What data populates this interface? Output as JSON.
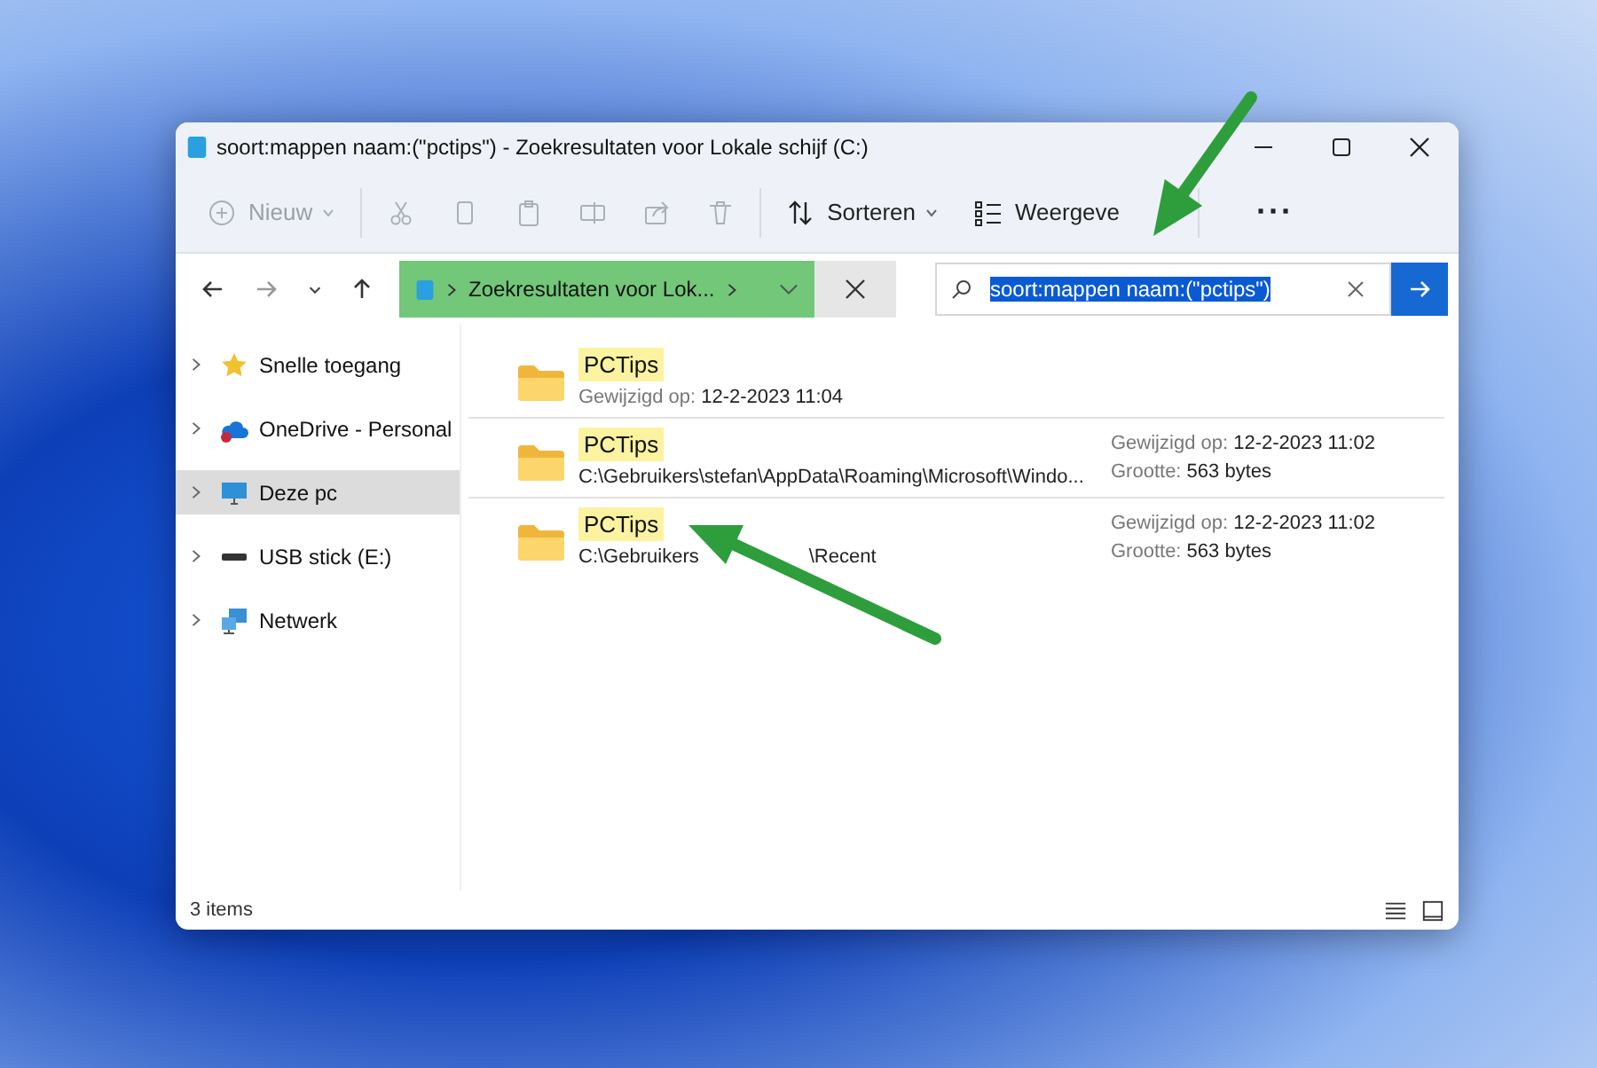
{
  "window": {
    "title": "soort:mappen naam:(\"pctips\") - Zoekresultaten voor Lokale schijf (C:)"
  },
  "toolbar": {
    "items": [
      {
        "kind": "new",
        "label": "Nieuw",
        "disabled": true
      },
      {
        "kind": "cut",
        "disabled": true
      },
      {
        "kind": "copy",
        "disabled": true
      },
      {
        "kind": "paste",
        "disabled": true
      },
      {
        "kind": "rename",
        "disabled": true
      },
      {
        "kind": "share",
        "disabled": true
      },
      {
        "kind": "delete",
        "disabled": true
      },
      {
        "kind": "sort",
        "label": "Sorteren",
        "disabled": false
      },
      {
        "kind": "view",
        "label": "Weergeve",
        "disabled": false
      },
      {
        "kind": "more",
        "label": "···",
        "disabled": false
      }
    ]
  },
  "address_bar": {
    "path": "Zoekresultaten voor Lok...",
    "highlighted": true
  },
  "search": {
    "value": "soort:mappen naam:(\"pctips\")",
    "selected": true
  },
  "sidebar": {
    "items": [
      {
        "kind": "star",
        "label": "Snelle toegang",
        "selected": false
      },
      {
        "kind": "cloud",
        "label": "OneDrive - Personal",
        "selected": false
      },
      {
        "kind": "pc",
        "label": "Deze pc",
        "selected": true
      },
      {
        "kind": "drive",
        "label": "USB stick (E:)",
        "selected": false
      },
      {
        "kind": "network",
        "label": "Netwerk",
        "selected": false
      }
    ]
  },
  "results": [
    {
      "name": "PCTips",
      "line2": {
        "label": "Gewijzigd op:",
        "value": "12-2-2023 11:04"
      }
    },
    {
      "name": "PCTips",
      "path": "C:\\Gebruikers\\stefan\\AppData\\Roaming\\Microsoft\\Windo...",
      "meta": [
        {
          "label": "Gewijzigd op:",
          "value": "12-2-2023 11:02"
        },
        {
          "label": "Grootte:",
          "value": "563 bytes"
        }
      ]
    },
    {
      "name": "PCTips",
      "path_fragments": [
        "C:\\Gebruikers",
        "\\Recent"
      ],
      "meta": [
        {
          "label": "Gewijzigd op:",
          "value": "12-2-2023 11:02"
        },
        {
          "label": "Grootte:",
          "value": "563 bytes"
        }
      ]
    }
  ],
  "status_bar": {
    "count": "3 items"
  }
}
